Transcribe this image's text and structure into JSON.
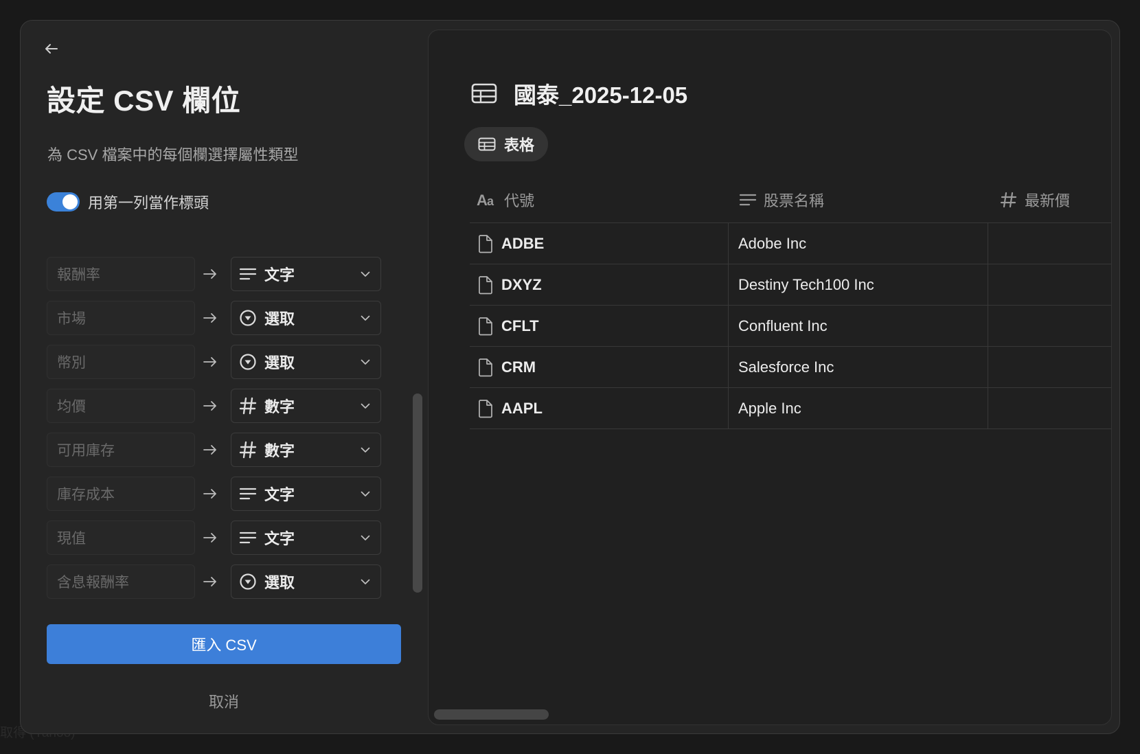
{
  "backdrop": {
    "hint": "取得 (Yahoo)"
  },
  "left": {
    "title": "設定 CSV 欄位",
    "subtitle": "為 CSV 檔案中的每個欄選擇屬性類型",
    "toggle": {
      "label": "用第一列當作標頭",
      "on": true
    },
    "fields": [
      {
        "source": "報酬率",
        "type": "文字",
        "icon": "text-lines-icon"
      },
      {
        "source": "市場",
        "type": "選取",
        "icon": "select-circle-icon"
      },
      {
        "source": "幣別",
        "type": "選取",
        "icon": "select-circle-icon"
      },
      {
        "source": "均價",
        "type": "數字",
        "icon": "number-hash-icon"
      },
      {
        "source": "可用庫存",
        "type": "數字",
        "icon": "number-hash-icon"
      },
      {
        "source": "庫存成本",
        "type": "文字",
        "icon": "text-lines-icon"
      },
      {
        "source": "現值",
        "type": "文字",
        "icon": "text-lines-icon"
      },
      {
        "source": "含息報酬率",
        "type": "選取",
        "icon": "select-circle-icon"
      }
    ],
    "import_label": "匯入 CSV",
    "cancel_label": "取消"
  },
  "preview": {
    "db_title": "國泰_2025-12-05",
    "view_tab": "表格",
    "columns": [
      {
        "icon": "title-aa-icon",
        "label": "代號"
      },
      {
        "icon": "text-lines-icon",
        "label": "股票名稱"
      },
      {
        "icon": "number-hash-icon",
        "label": "最新價"
      }
    ],
    "rows": [
      {
        "code": "ADBE",
        "name": "Adobe Inc",
        "price": ""
      },
      {
        "code": "DXYZ",
        "name": "Destiny Tech100 Inc",
        "price": ""
      },
      {
        "code": "CFLT",
        "name": "Confluent Inc",
        "price": ""
      },
      {
        "code": "CRM",
        "name": "Salesforce Inc",
        "price": ""
      },
      {
        "code": "AAPL",
        "name": "Apple Inc",
        "price": ""
      }
    ]
  },
  "colors": {
    "accent": "#3d7fd9",
    "toggle_on": "#3b82d9",
    "modal_bg": "#252525"
  }
}
